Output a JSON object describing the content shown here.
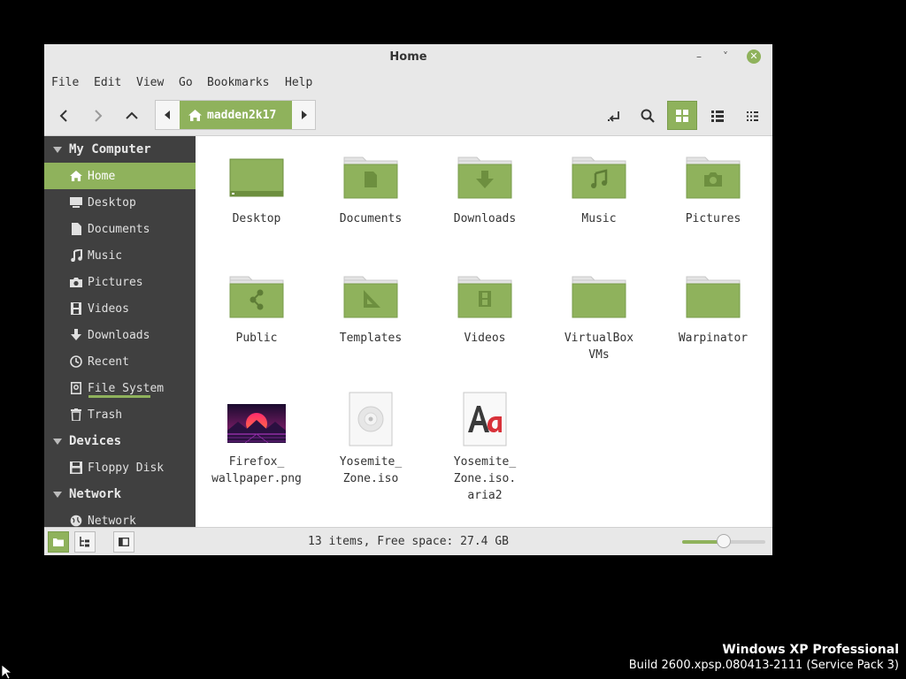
{
  "window": {
    "title": "Home",
    "controls": {
      "minimize": "–",
      "maximize": "˅",
      "close": "✕"
    }
  },
  "menu": [
    "File",
    "Edit",
    "View",
    "Go",
    "Bookmarks",
    "Help"
  ],
  "path": {
    "current": "madden2k17"
  },
  "sidebar": {
    "sections": [
      {
        "label": "My Computer"
      },
      {
        "label": "Devices"
      },
      {
        "label": "Network"
      }
    ],
    "my_computer": [
      {
        "label": "Home",
        "icon": "home-icon"
      },
      {
        "label": "Desktop",
        "icon": "desktop-icon"
      },
      {
        "label": "Documents",
        "icon": "document-icon"
      },
      {
        "label": "Music",
        "icon": "music-note-icon"
      },
      {
        "label": "Pictures",
        "icon": "camera-icon"
      },
      {
        "label": "Videos",
        "icon": "film-icon"
      },
      {
        "label": "Downloads",
        "icon": "download-arrow-icon"
      },
      {
        "label": "Recent",
        "icon": "clock-icon"
      },
      {
        "label": "File System",
        "icon": "drive-icon"
      },
      {
        "label": "Trash",
        "icon": "trash-icon"
      }
    ],
    "devices": [
      {
        "label": "Floppy Disk",
        "icon": "floppy-icon"
      }
    ],
    "network": [
      {
        "label": "Network",
        "icon": "globe-icon"
      }
    ]
  },
  "files": [
    {
      "name": "Desktop",
      "icon": "folder-desktop-icon"
    },
    {
      "name": "Documents",
      "icon": "folder-documents-icon"
    },
    {
      "name": "Downloads",
      "icon": "folder-downloads-icon"
    },
    {
      "name": "Music",
      "icon": "folder-music-icon"
    },
    {
      "name": "Pictures",
      "icon": "folder-pictures-icon"
    },
    {
      "name": "Public",
      "icon": "folder-public-icon"
    },
    {
      "name": "Templates",
      "icon": "folder-templates-icon"
    },
    {
      "name": "Videos",
      "icon": "folder-videos-icon"
    },
    {
      "name": "VirtualBox\nVMs",
      "icon": "folder-icon"
    },
    {
      "name": "Warpinator",
      "icon": "folder-icon"
    },
    {
      "name": "Firefox_\nwallpaper.png",
      "icon": "image-thumbnail-icon"
    },
    {
      "name": "Yosemite_\nZone.iso",
      "icon": "disc-image-icon"
    },
    {
      "name": "Yosemite_\nZone.iso.\naria2",
      "icon": "font-file-icon"
    }
  ],
  "status": {
    "text": "13 items, Free space: 27.4 GB",
    "zoom_level": 0.5
  },
  "os_brand": {
    "line1": "Windows XP Professional",
    "line2": "Build 2600.xpsp.080413-2111 (Service Pack 3)"
  },
  "colors": {
    "accent": "#8fb25c",
    "sidebar_bg": "#404040",
    "chrome_bg": "#e8e8e8",
    "folder_front": "#8fb25c",
    "folder_back": "#e4e4e4"
  }
}
